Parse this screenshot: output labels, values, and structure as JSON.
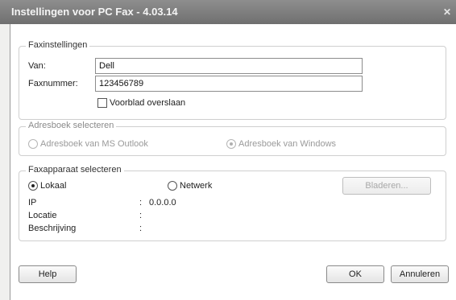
{
  "window": {
    "title": "Instellingen voor PC Fax - 4.03.14",
    "close_glyph": "✕"
  },
  "fax_settings": {
    "legend": "Faxinstellingen",
    "from_label": "Van:",
    "from_value": "Dell",
    "fax_number_label": "Faxnummer:",
    "fax_number_value": "123456789",
    "skip_cover_label": "Voorblad overslaan",
    "skip_cover_checked": false
  },
  "address_book": {
    "legend": "Adresboek selecteren",
    "option_outlook": "Adresboek van MS Outlook",
    "option_windows": "Adresboek van Windows",
    "selected": "windows",
    "disabled": true
  },
  "fax_device": {
    "legend": "Faxapparaat selecteren",
    "option_local": "Lokaal",
    "option_network": "Netwerk",
    "selected": "local",
    "browse_label": "Bladeren...",
    "ip_label": "IP",
    "ip_value": "0.0.0.0",
    "location_label": "Locatie",
    "description_label": "Beschrijving",
    "separator": ":"
  },
  "footer": {
    "help_label": "Help",
    "ok_label": "OK",
    "cancel_label": "Annuleren"
  }
}
